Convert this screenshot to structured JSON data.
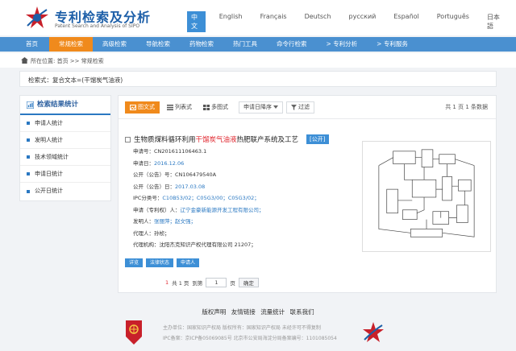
{
  "header": {
    "title": "专利检索及分析",
    "subtitle": "Patent Search and Analysis of SIPO",
    "languages": [
      "中文",
      "English",
      "Français",
      "Deutsch",
      "русский",
      "Español",
      "Português",
      "日本語"
    ]
  },
  "nav": {
    "items": [
      "首页",
      "常规检索",
      "高级检索",
      "导航检索",
      "药物检索",
      "热门工具",
      "命令行检索",
      "> 专利分析",
      "> 专利服务"
    ]
  },
  "breadcrumb": {
    "text": "所在位置: 首页 >> 常规检索"
  },
  "query": {
    "text": "检索式：复合文本=(干馏炭气油液)"
  },
  "sidebar": {
    "title": "检索结果统计",
    "items": [
      "申请人统计",
      "发明人统计",
      "技术领域统计",
      "申请日统计",
      "公开日统计"
    ]
  },
  "toolbar": {
    "view_figure": "图文式",
    "view_list": "列表式",
    "view_multi": "多图式",
    "sort": "申请日降序",
    "filter": "过滤",
    "stats": "共 1 页 1 条数据"
  },
  "result": {
    "title_prefix": "生物质煤料循环利用",
    "title_highlight": "干馏炭气油液",
    "title_suffix": "热肥联产系统及工艺",
    "tag": "[公开]",
    "fields": [
      {
        "label": "申请号：",
        "value": "CN201611106463.1",
        "blue": false
      },
      {
        "label": "申请日：",
        "value": "2016.12.06",
        "blue": true
      },
      {
        "label": "公开（公告）号：",
        "value": "CN106479540A",
        "blue": false
      },
      {
        "label": "公开（公告）日：",
        "value": "2017.03.08",
        "blue": true
      },
      {
        "label": "IPC分类号：",
        "value": "C10B53/02；C05G3/00；C05G3/02；",
        "blue": true
      },
      {
        "label": "申请（专利权）人：",
        "value": "辽宁金豪新能源开发工程有限公司；",
        "blue": true
      },
      {
        "label": "发明人：",
        "value": "张丽萍；赵文强；",
        "blue": true
      },
      {
        "label": "代理人：",
        "value": "孙桢；",
        "blue": false
      },
      {
        "label": "代理机构：",
        "value": "沈阳杰克知识产权代理有限公司 21207；",
        "blue": false
      }
    ],
    "actions": [
      "详览",
      "法律状态",
      "申请人"
    ]
  },
  "pager": {
    "total": "共 1 页",
    "goto": "到第",
    "page": "1",
    "unit": "页",
    "confirm": "确定"
  },
  "footer": {
    "links": [
      "版权声明",
      "友情链接",
      "流量统计",
      "联系我们"
    ],
    "line1": "主办单位：国家知识产权局    版权所有：国家知识产权局    未经许可不得复制",
    "line2": "IPC备案：京ICP备05069085号  北京市公安局海淀分局备案编号：1101085054"
  }
}
